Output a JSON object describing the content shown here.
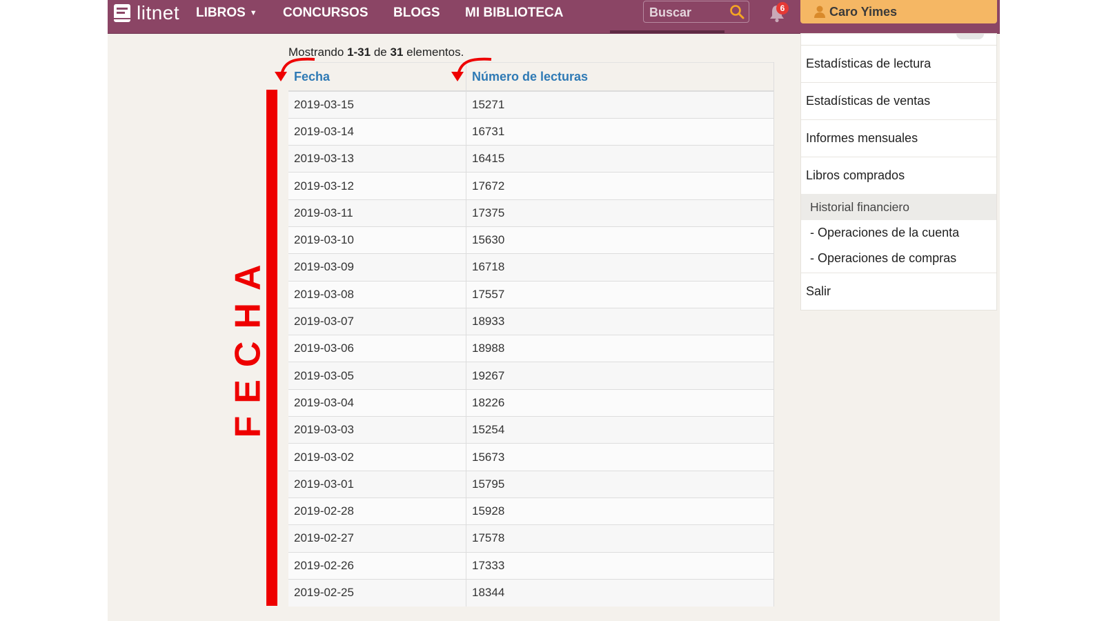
{
  "header": {
    "logo_text": "litnet",
    "nav": [
      {
        "label": "LIBROS",
        "has_caret": true
      },
      {
        "label": "CONCURSOS"
      },
      {
        "label": "BLOGS"
      },
      {
        "label": "MI BIBLIOTECA"
      }
    ],
    "search_placeholder": "Buscar",
    "notifications_count": "6",
    "user_name": "Caro Yimes",
    "colors": {
      "bar": "#8b4565",
      "user_button": "#f5b764",
      "badge": "#e53935"
    }
  },
  "summary": {
    "prefix": "Mostrando",
    "range": "1-31",
    "mid": "de",
    "total": "31",
    "suffix": "elementos."
  },
  "table": {
    "columns": [
      "Fecha",
      "Número de lecturas"
    ],
    "rows": [
      [
        "2019-03-15",
        "15271"
      ],
      [
        "2019-03-14",
        "16731"
      ],
      [
        "2019-03-13",
        "16415"
      ],
      [
        "2019-03-12",
        "17672"
      ],
      [
        "2019-03-11",
        "17375"
      ],
      [
        "2019-03-10",
        "15630"
      ],
      [
        "2019-03-09",
        "16718"
      ],
      [
        "2019-03-08",
        "17557"
      ],
      [
        "2019-03-07",
        "18933"
      ],
      [
        "2019-03-06",
        "18988"
      ],
      [
        "2019-03-05",
        "19267"
      ],
      [
        "2019-03-04",
        "18226"
      ],
      [
        "2019-03-03",
        "15254"
      ],
      [
        "2019-03-02",
        "15673"
      ],
      [
        "2019-03-01",
        "15795"
      ],
      [
        "2019-02-28",
        "15928"
      ],
      [
        "2019-02-27",
        "17578"
      ],
      [
        "2019-02-26",
        "17333"
      ],
      [
        "2019-02-25",
        "18344"
      ]
    ]
  },
  "annotation": {
    "label": "FECHA",
    "color": "#ee0000"
  },
  "sidebar": {
    "items": [
      "Estadísticas de lectura",
      "Estadísticas de ventas",
      "Informes mensuales",
      "Libros comprados"
    ],
    "section_title": "Historial financiero",
    "sub_items": [
      "- Operaciones de la cuenta",
      "- Operaciones de compras"
    ],
    "logout": "Salir"
  }
}
